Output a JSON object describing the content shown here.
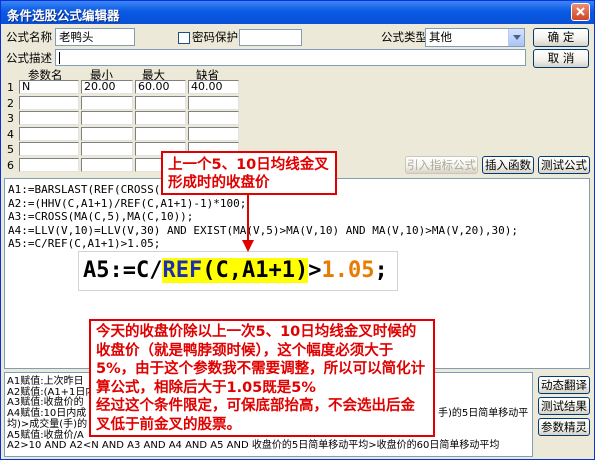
{
  "window": {
    "title": "条件选股公式编辑器"
  },
  "form": {
    "name_label": "公式名称",
    "name_value": "老鸭头",
    "password_label": "密码保护",
    "password_checked": false,
    "password_value": "",
    "type_label": "公式类型",
    "type_value": "其他",
    "desc_label": "公式描述",
    "desc_value": "",
    "ok_label": "确 定",
    "cancel_label": "取 消"
  },
  "params": {
    "headers": [
      "参数名",
      "最小",
      "最大",
      "缺省"
    ],
    "rows": [
      {
        "index": "1",
        "name": "N",
        "min": "20.00",
        "max": "60.00",
        "default": "40.00"
      },
      {
        "index": "2",
        "name": "",
        "min": "",
        "max": "",
        "default": ""
      },
      {
        "index": "3",
        "name": "",
        "min": "",
        "max": "",
        "default": ""
      },
      {
        "index": "4",
        "name": "",
        "min": "",
        "max": "",
        "default": ""
      },
      {
        "index": "5",
        "name": "",
        "min": "",
        "max": "",
        "default": ""
      },
      {
        "index": "6",
        "name": "",
        "min": "",
        "max": "",
        "default": ""
      }
    ]
  },
  "toolbar": {
    "import_label": "引入指标公式",
    "insert_label": "插入函数",
    "test_label": "测试公式"
  },
  "formula": {
    "lines": [
      "A1:=BARSLAST(REF(CROSS(",
      "A2:=(HHV(C,A1+1)/REF(C,A1+1)-1)*100;",
      "A3:=CROSS(MA(C,5),MA(C,10));",
      "A4:=LLV(V,10)=LLV(V,30) AND EXIST(MA(V,5)>MA(V,10) AND MA(V,10)>MA(V,20),30);",
      "A5:=C/REF(C,A1+1)>1.05;"
    ]
  },
  "zoom": {
    "prefix": "A5:=C/",
    "func": "REF",
    "args": "(C,A1+1)",
    "op": ">",
    "value": "1.05",
    "suffix": ";"
  },
  "annotations": {
    "top": [
      "上一个5、10日均线金叉",
      "形成时的收盘价"
    ],
    "main": [
      "今天的收盘价除以上一次5、10日均线金叉时候的",
      "收盘价（就是鸭脖颈时候），这个幅度必须大于",
      "5%，由于这个参数我不需要调整，所以可以简化计",
      "算公式，相除后大于1.05既是5%",
      "经过这个条件限定，可保底部抬高，不会选出后金",
      "叉低于前金叉的股票。"
    ]
  },
  "explanation": {
    "lines": [
      "A1赋值:上次昨日",
      "A2赋值:(A1+1日内",
      "A3赋值:收盘价的",
      "A4赋值:10日内成",
      "均)>成交量(手)的",
      "A5赋值:收盘价/A",
      "A2>10 AND A2<N AND A3 AND A4 AND A5 AND 收盘价的5日简单移动平均>收盘价的60日简单移动平均"
    ],
    "line4_tail": "手)的5日简单移动平"
  },
  "side_buttons": {
    "translate_label": "动态翻译",
    "result_label": "测试结果",
    "wizard_label": "参数精灵"
  },
  "icons": {
    "close": "close-icon",
    "dropdown": "chevron-down-icon",
    "arrow": "annotation-arrow"
  },
  "colors": {
    "annotation_red": "#E00000",
    "highlight": "#FFFF00",
    "zoom_value": "#E87B00",
    "zoom_func": "#1F2FB0",
    "face": "#ECE9D8"
  }
}
